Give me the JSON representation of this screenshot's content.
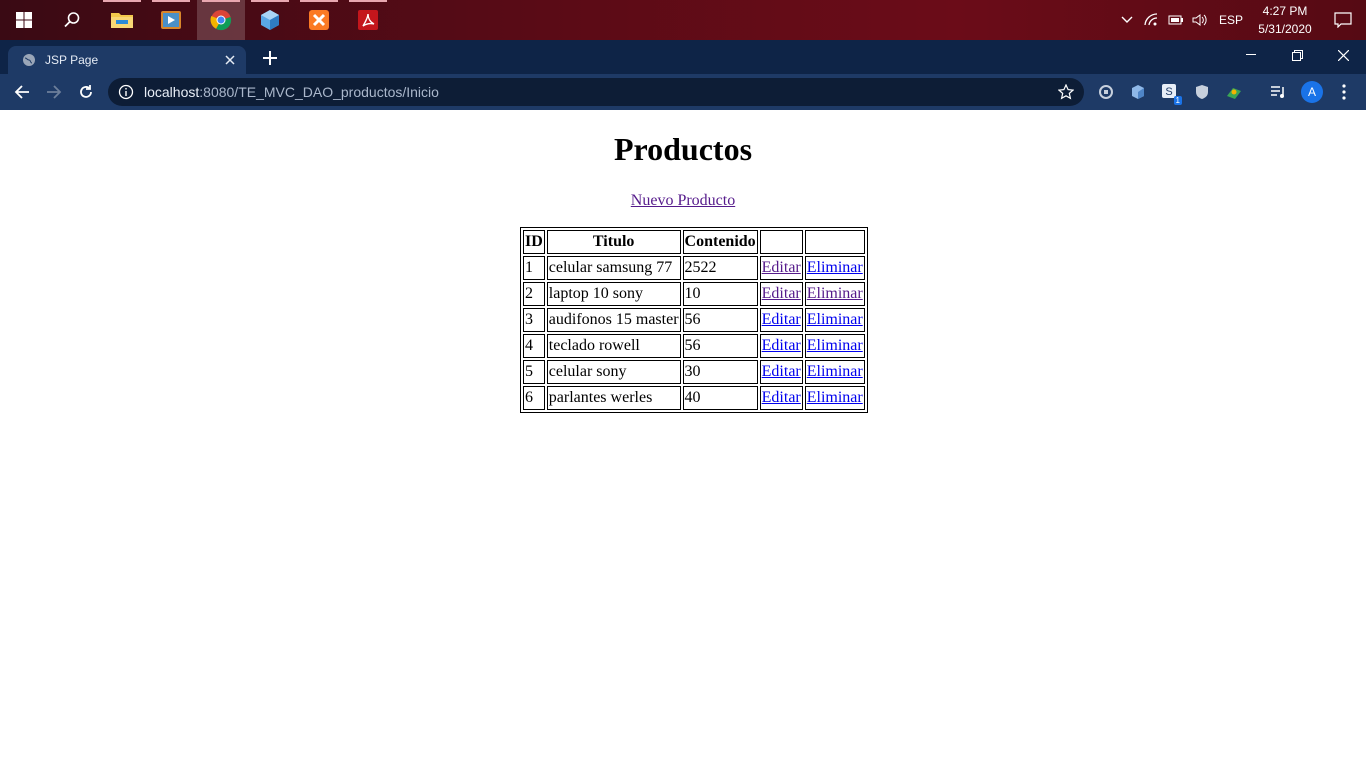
{
  "taskbar": {
    "apps": [
      {
        "icon": "file-explorer-icon"
      },
      {
        "icon": "media-player-icon"
      },
      {
        "icon": "chrome-icon",
        "active": true
      },
      {
        "icon": "virtualbox-icon"
      },
      {
        "icon": "xampp-icon"
      },
      {
        "icon": "acrobat-icon"
      }
    ],
    "language": "ESP",
    "time": "4:27 PM",
    "date": "5/31/2020"
  },
  "browser": {
    "tab_title": "JSP Page",
    "url_host": "localhost",
    "url_path": ":8080/TE_MVC_DAO_productos/Inicio",
    "avatar_letter": "A",
    "ext_badge": "1"
  },
  "page": {
    "title": "Productos",
    "new_link": "Nuevo Producto",
    "columns": [
      "ID",
      "Titulo",
      "Contenido",
      "",
      ""
    ],
    "rows": [
      {
        "id": "1",
        "titulo": "celular samsung 77",
        "contenido": "2522",
        "edit": "Editar",
        "delete": "Eliminar"
      },
      {
        "id": "2",
        "titulo": "laptop 10 sony",
        "contenido": "10",
        "edit": "Editar",
        "delete": "Eliminar"
      },
      {
        "id": "3",
        "titulo": "audifonos 15 master",
        "contenido": "56",
        "edit": "Editar",
        "delete": "Eliminar"
      },
      {
        "id": "4",
        "titulo": "teclado rowell",
        "contenido": "56",
        "edit": "Editar",
        "delete": "Eliminar"
      },
      {
        "id": "5",
        "titulo": "celular sony",
        "contenido": "30",
        "edit": "Editar",
        "delete": "Eliminar"
      },
      {
        "id": "6",
        "titulo": "parlantes werles",
        "contenido": "40",
        "edit": "Editar",
        "delete": "Eliminar"
      }
    ]
  }
}
